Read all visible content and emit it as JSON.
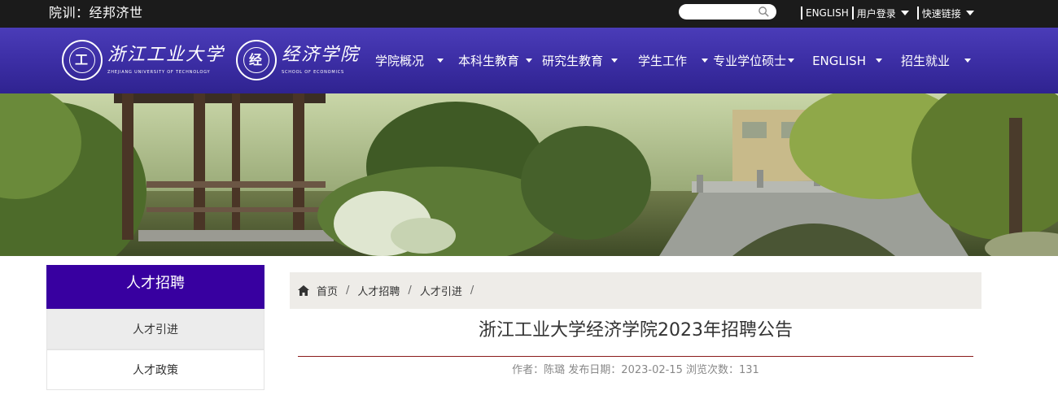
{
  "topbar": {
    "motto": "院训：经邦济世",
    "links": [
      {
        "label": "ENGLISH",
        "has_dropdown": false
      },
      {
        "label": "用户登录",
        "has_dropdown": true
      },
      {
        "label": "快速链接",
        "has_dropdown": true
      }
    ]
  },
  "header": {
    "logo_university_cn": "浙江工业大学",
    "logo_university_en": "ZHEJIANG UNIVERSITY OF TECHNOLOGY",
    "logo_school_cn": "经济学院",
    "logo_school_en": "SCHOOL OF ECONOMICS",
    "nav": [
      {
        "label": "学院概况"
      },
      {
        "label": "本科生教育"
      },
      {
        "label": "研究生教育"
      },
      {
        "label": "学生工作"
      },
      {
        "label": "专业学位硕士"
      },
      {
        "label": "ENGLISH"
      },
      {
        "label": "招生就业"
      }
    ]
  },
  "sidebar": {
    "title": "人才招聘",
    "items": [
      {
        "label": "人才引进",
        "active": true
      },
      {
        "label": "人才政策",
        "active": false
      }
    ]
  },
  "breadcrumb": {
    "items": [
      "首页",
      "人才招聘",
      "人才引进"
    ],
    "separator": "/"
  },
  "article": {
    "title": "浙江工业大学经济学院2023年招聘公告",
    "meta": "作者：陈璐 发布日期：2023-02-15 浏览次数：131"
  },
  "colors": {
    "topbar": "#1b1b1b",
    "header": "#3b2da3",
    "sidebar_title": "#3800a0",
    "rule": "#8a1a1a"
  },
  "icons": {
    "search": "search-icon",
    "home": "home-icon",
    "dropdown": "caret-down-icon"
  }
}
